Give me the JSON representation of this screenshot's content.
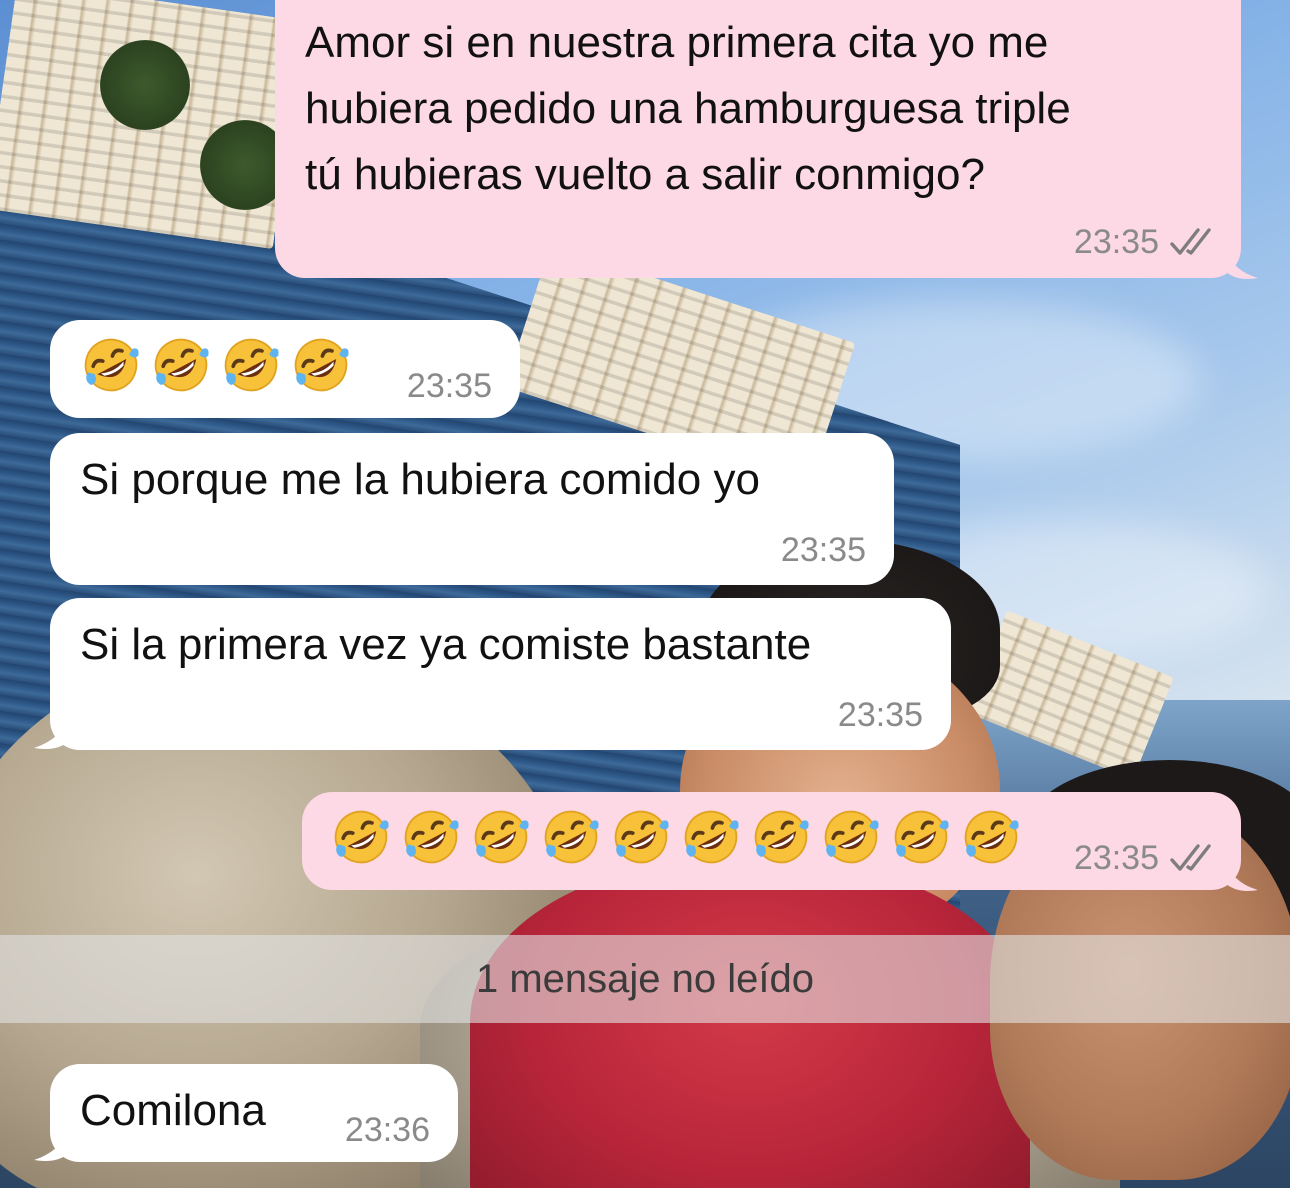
{
  "messages": [
    {
      "id": "m1",
      "direction": "out",
      "text": "Amor si en nuestra primera cita yo me\nhubiera pedido una hamburguesa triple\ntú hubieras vuelto a salir conmigo?",
      "time": "23:35",
      "read": true
    },
    {
      "id": "m2",
      "direction": "in",
      "emoji_count": 4,
      "emoji_name": "rolling-on-floor-laughing",
      "time": "23:35"
    },
    {
      "id": "m3",
      "direction": "in",
      "text": "Si porque me la hubiera comido yo",
      "time": "23:35"
    },
    {
      "id": "m4",
      "direction": "in",
      "text": "Si la primera vez ya comiste bastante",
      "time": "23:35"
    },
    {
      "id": "m5",
      "direction": "out",
      "emoji_count": 10,
      "emoji_name": "rolling-on-floor-laughing",
      "time": "23:35",
      "read": true
    },
    {
      "id": "m6",
      "direction": "in",
      "text": "Comilona",
      "time": "23:36"
    }
  ],
  "unread_banner": "1 mensaje no leído",
  "colors": {
    "outgoing_bubble": "#fdd8e5",
    "incoming_bubble": "#ffffff",
    "timestamp": "#8a8a8a",
    "read_ticks": "#7d7d7d"
  },
  "icons": {
    "read_receipt": "double-check-icon",
    "emoji": "rolling-on-floor-laughing-emoji"
  }
}
